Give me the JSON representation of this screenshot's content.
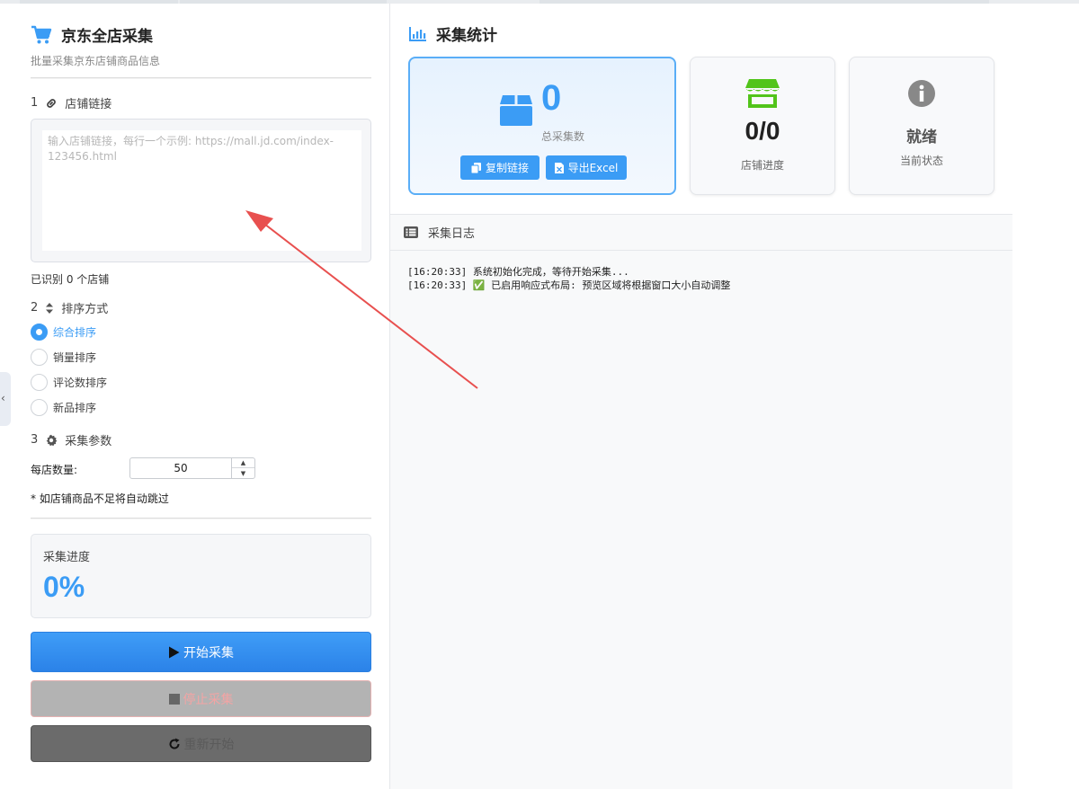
{
  "app": {
    "title": "京东全店采集",
    "subtitle": "批量采集京东店铺商品信息"
  },
  "section1": {
    "number": "1",
    "label": "店铺链接",
    "textarea_placeholder": "输入店铺链接，每行一个示例: https://mall.jd.com/index-123456.html",
    "textarea_value": "",
    "recognized": "已识别 0 个店铺"
  },
  "section2": {
    "number": "2",
    "label": "排序方式",
    "options": [
      {
        "label": "综合排序",
        "checked": true
      },
      {
        "label": "销量排序",
        "checked": false
      },
      {
        "label": "评论数排序",
        "checked": false
      },
      {
        "label": "新品排序",
        "checked": false
      }
    ]
  },
  "section3": {
    "number": "3",
    "label": "采集参数",
    "qty_label": "每店数量:",
    "qty_value": "50",
    "note": "* 如店铺商品不足将自动跳过"
  },
  "progress": {
    "label": "采集进度",
    "value": "0%"
  },
  "buttons": {
    "start": "开始采集",
    "stop": "停止采集",
    "reset": "重新开始"
  },
  "stats": {
    "title": "采集统计",
    "total_value": "0",
    "total_label": "总采集数",
    "copy_button": "复制链接",
    "export_button": "导出Excel",
    "shop_value": "0/0",
    "shop_label": "店铺进度",
    "state_value": "就绪",
    "state_label": "当前状态"
  },
  "log": {
    "title": "采集日志",
    "lines": [
      "[16:20:33] 系统初始化完成，等待开始采集...",
      "[16:20:33] ✅ 已启用响应式布局: 预览区域将根据窗口大小自动调整"
    ]
  },
  "colors": {
    "accent": "#3b9cf5",
    "shop_icon": "#52c41a",
    "annotation_arrow": "#e8504f"
  },
  "icons": [
    "cart-icon",
    "link-icon",
    "sort-icon",
    "gear-icon",
    "play-icon",
    "stop-icon",
    "refresh-icon",
    "chart-icon",
    "box-icon",
    "copy-icon",
    "excel-icon",
    "store-icon",
    "info-icon",
    "list-icon"
  ]
}
